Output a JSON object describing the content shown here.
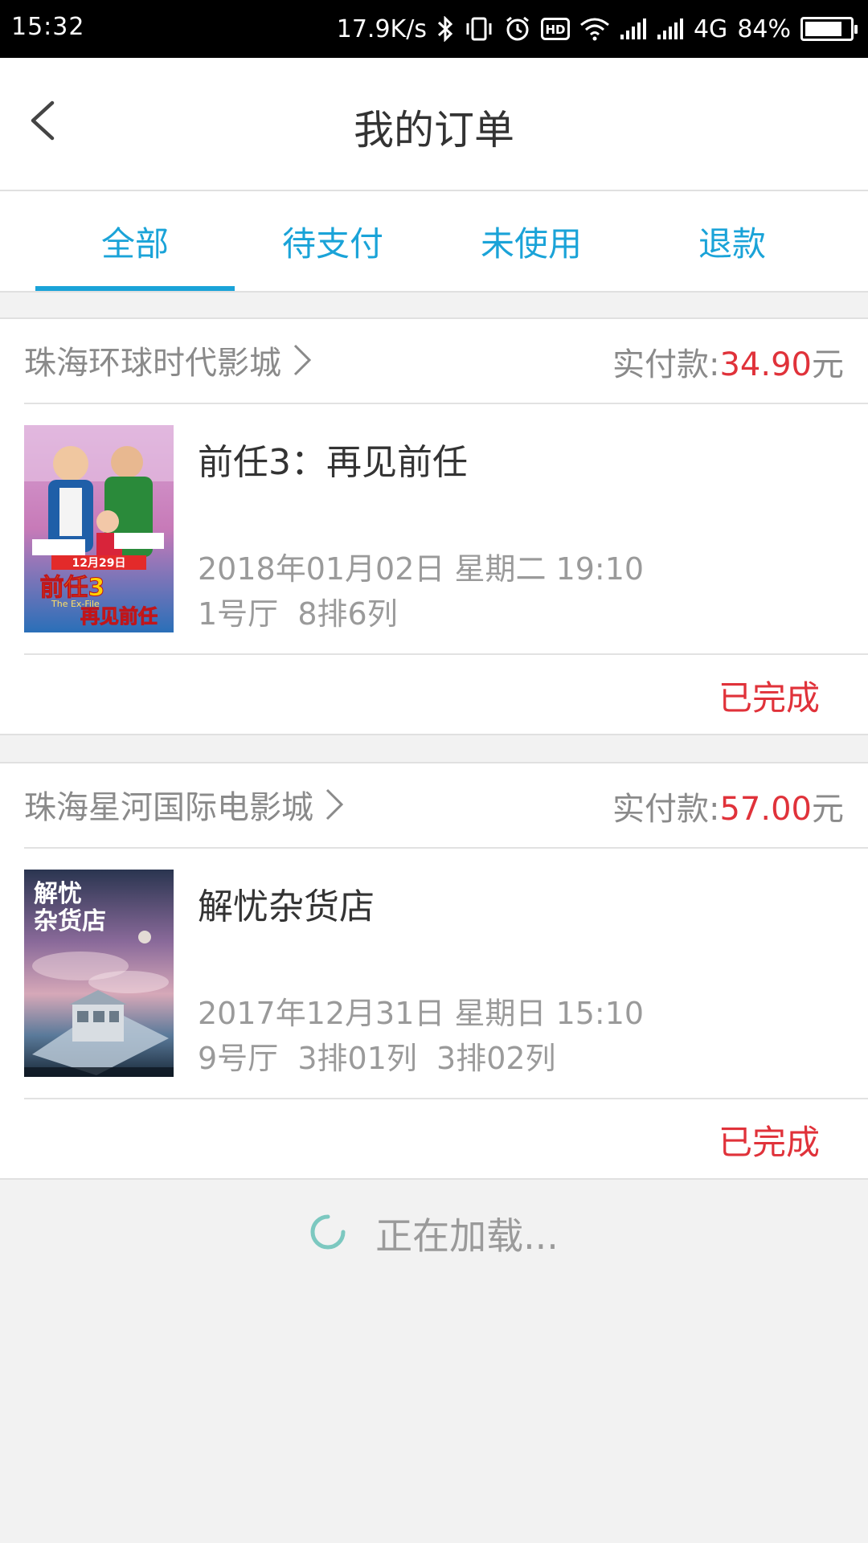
{
  "status_bar": {
    "time": "15:32",
    "network_speed": "17.9K/s",
    "hd_label": "HD",
    "network_type": "4G",
    "battery": "84%",
    "battery_level": 0.84,
    "icons": [
      "bluetooth-icon",
      "vibrate-icon",
      "alarm-icon",
      "hd-icon",
      "wifi-icon",
      "signal-icon",
      "signal-icon-2",
      "battery-icon"
    ]
  },
  "header": {
    "title": "我的订单",
    "back_icon": "chevron-left-icon"
  },
  "tabs": [
    {
      "label": "全部",
      "active": true
    },
    {
      "label": "待支付",
      "active": false
    },
    {
      "label": "未使用",
      "active": false
    },
    {
      "label": "退款",
      "active": false
    }
  ],
  "colors": {
    "accent": "#1aa3d8",
    "price": "#e0323a",
    "status": "#e0323a",
    "spinner": "#7cc8c0"
  },
  "orders": [
    {
      "cinema": "珠海环球时代影城",
      "paid_label": "实付款:",
      "amount": "34.90",
      "currency": "元",
      "movie_title": "前任3：再见前任",
      "datetime": "2018年01月02日 星期二 19:10",
      "seats": "1号厅  8排6列",
      "status": "已完成",
      "poster_title": "前任3",
      "poster_subtitle": "再见前任",
      "poster_date": "12月29日",
      "poster_en": "The Ex-File"
    },
    {
      "cinema": "珠海星河国际电影城",
      "paid_label": "实付款:",
      "amount": "57.00",
      "currency": "元",
      "movie_title": "解忧杂货店",
      "datetime": "2017年12月31日 星期日 15:10",
      "seats": "9号厅  3排01列  3排02列",
      "status": "已完成",
      "poster_title": "解忧",
      "poster_subtitle": "杂货店"
    }
  ],
  "loading": {
    "text": "正在加载..."
  }
}
